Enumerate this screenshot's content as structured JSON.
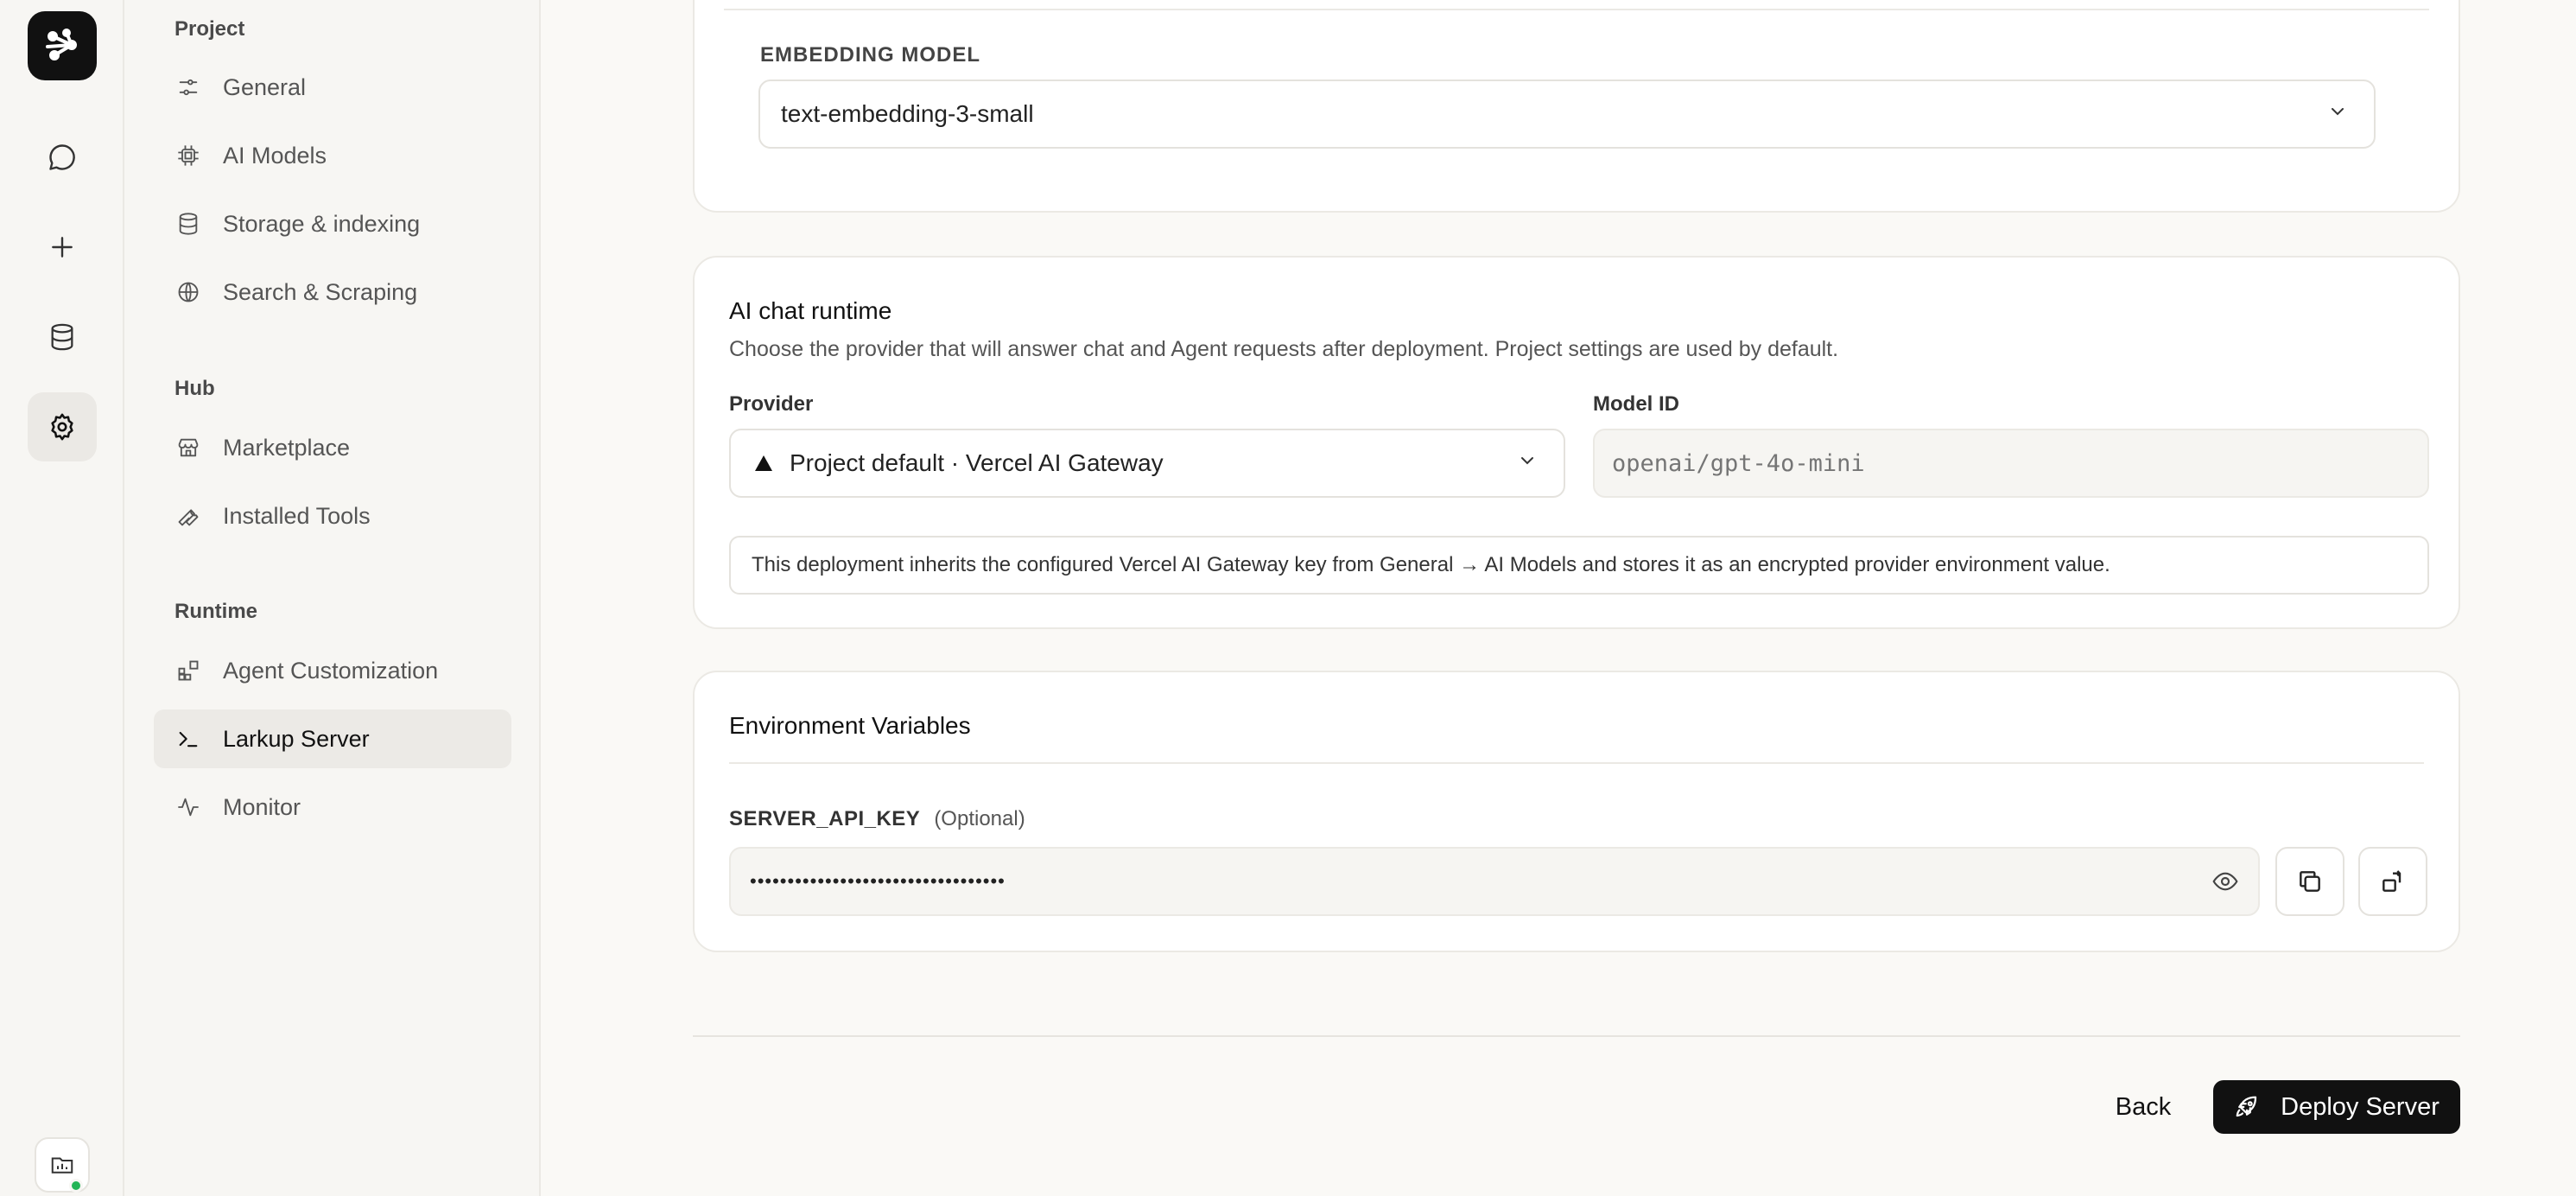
{
  "sidebar": {
    "sections": [
      {
        "title": "Project",
        "items": [
          {
            "label": "General",
            "icon": "sliders-icon"
          },
          {
            "label": "AI Models",
            "icon": "chip-icon"
          },
          {
            "label": "Storage & indexing",
            "icon": "database-icon"
          },
          {
            "label": "Search & Scraping",
            "icon": "globe-icon"
          }
        ]
      },
      {
        "title": "Hub",
        "items": [
          {
            "label": "Marketplace",
            "icon": "store-icon"
          },
          {
            "label": "Installed Tools",
            "icon": "wrench-icon"
          }
        ]
      },
      {
        "title": "Runtime",
        "items": [
          {
            "label": "Agent Customization",
            "icon": "blocks-icon"
          },
          {
            "label": "Larkup Server",
            "icon": "terminal-icon",
            "active": true
          },
          {
            "label": "Monitor",
            "icon": "activity-icon"
          }
        ]
      }
    ]
  },
  "embedding": {
    "label": "EMBEDDING MODEL",
    "value": "text-embedding-3-small"
  },
  "runtime": {
    "title": "AI chat runtime",
    "description": "Choose the provider that will answer chat and Agent requests after deployment. Project settings are used by default.",
    "provider_label": "Provider",
    "provider_value": "Project default · Vercel AI Gateway",
    "model_label": "Model ID",
    "model_placeholder": "openai/gpt-4o-mini",
    "notice": "This deployment inherits the configured Vercel AI Gateway key from General → AI Models and stores it as an encrypted provider environment value."
  },
  "env": {
    "title": "Environment Variables",
    "key_label": "SERVER_API_KEY",
    "key_optional": "(Optional)",
    "key_value": "••••••••••••••••••••••••••••••••••"
  },
  "footer": {
    "back_label": "Back",
    "deploy_label": "Deploy Server"
  },
  "colors": {
    "accent": "#111111",
    "status_online": "#22b455"
  }
}
